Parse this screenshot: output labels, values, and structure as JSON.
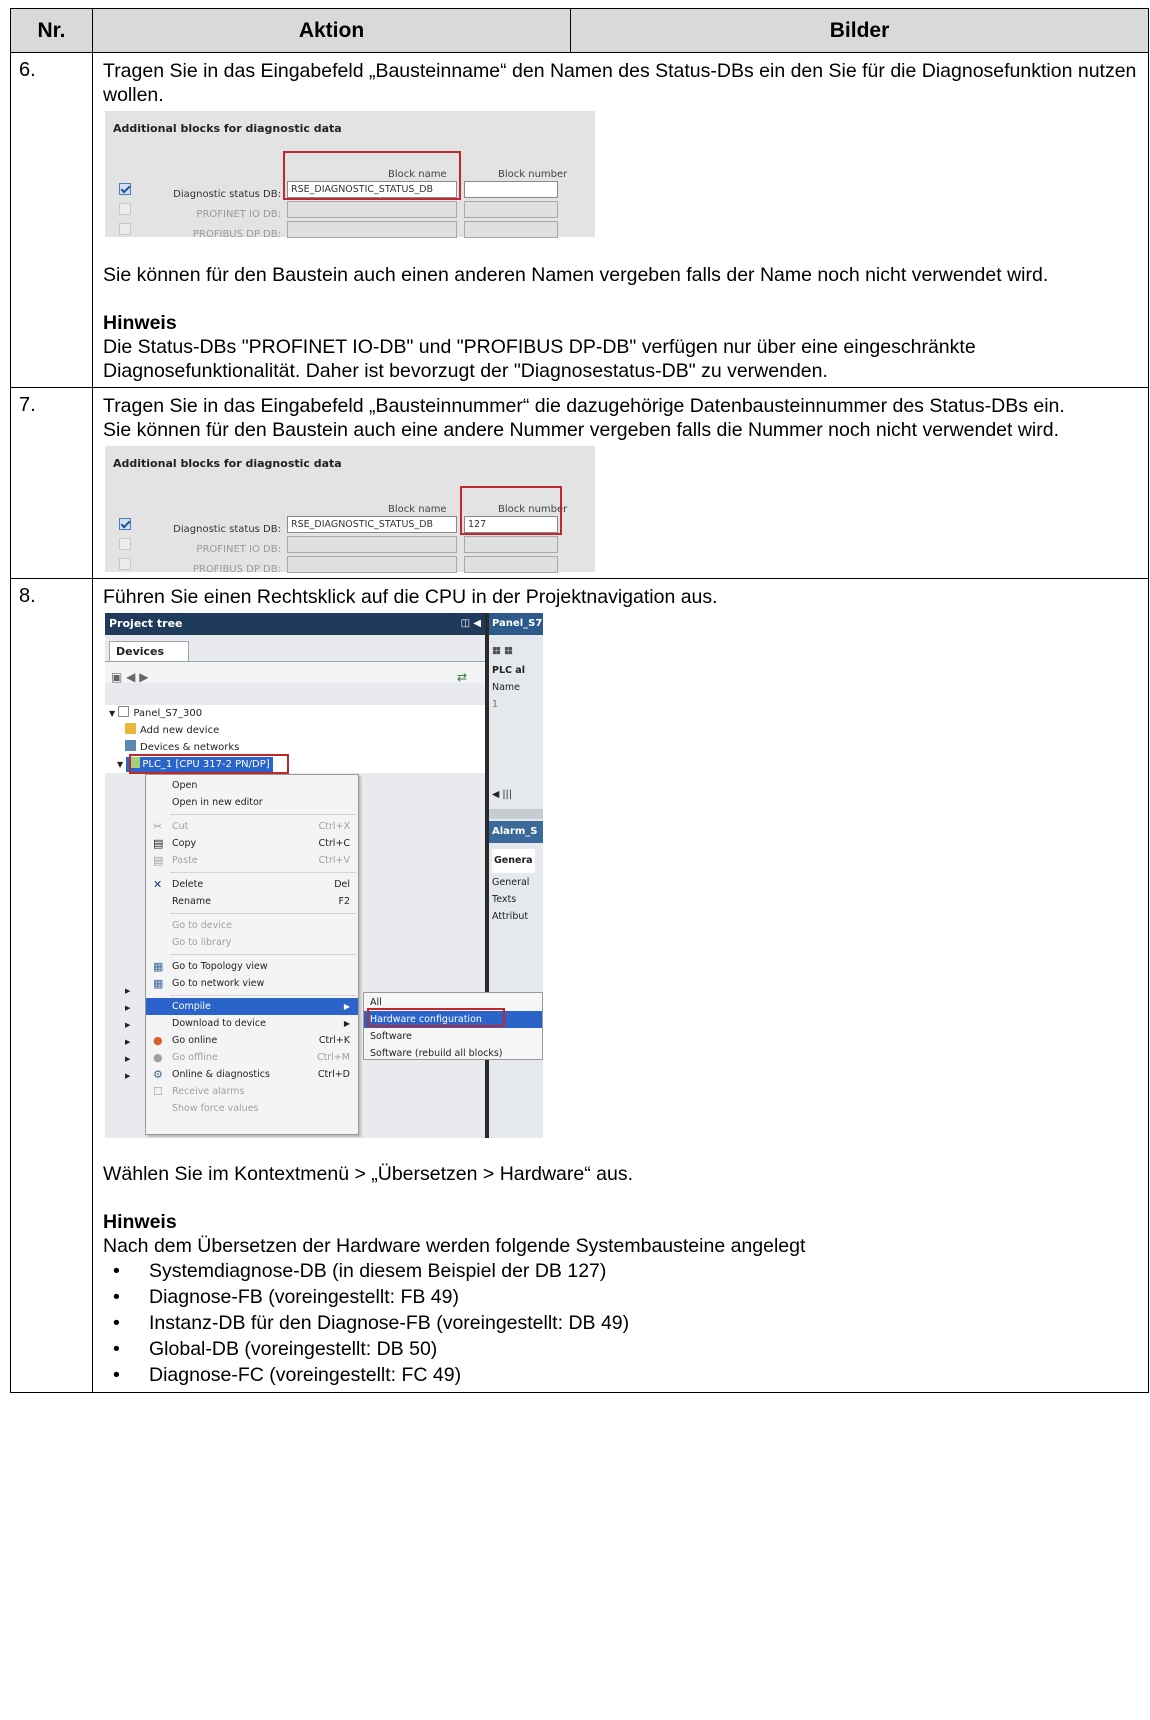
{
  "headers": {
    "nr": "Nr.",
    "aktion": "Aktion",
    "bilder": "Bilder"
  },
  "rows": [
    {
      "nr": "6.",
      "intro": "Tragen Sie in das Eingabefeld „Bausteinname“ den Namen des Status-DBs ein den Sie für die Diagnosefunktion nutzen wollen.",
      "after": "Sie können für den Baustein auch einen anderen Namen vergeben falls der Name noch nicht verwendet wird.",
      "hinweis_title": "Hinweis",
      "hinweis_text": "Die Status-DBs \"PROFINET IO-DB\" und \"PROFIBUS DP-DB\" verfügen nur über eine eingeschränkte Diagnosefunktionalität. Daher ist bevorzugt der \"Diagnosestatus-DB\" zu verwenden."
    },
    {
      "nr": "7.",
      "intro": "Tragen Sie in das Eingabefeld „Bausteinnummer“ die dazugehörige Datenbausteinnummer des Status-DBs ein.",
      "intro2": "Sie können für den Baustein auch eine andere Nummer vergeben falls die Nummer noch nicht verwendet wird."
    },
    {
      "nr": "8.",
      "intro": "Führen Sie einen Rechtsklick auf die CPU in der Projektnavigation aus.",
      "after": "Wählen Sie im Kontextmenü > „Übersetzen > Hardware“ aus.",
      "hinweis_title": "Hinweis",
      "hinweis_text": "Nach dem Übersetzen der Hardware werden folgende Systembausteine angelegt",
      "bullets": [
        "Systemdiagnose-DB (in diesem Beispiel der DB 127)",
        "Diagnose-FB (voreingestellt: FB 49)",
        "Instanz-DB für den Diagnose-FB (voreingestellt: DB 49)",
        "Global-DB (voreingestellt: DB 50)",
        "Diagnose-FC (voreingestellt: FC 49)"
      ]
    }
  ],
  "panel1": {
    "title": "Additional blocks for diagnostic data",
    "col_name": "Block name",
    "col_number": "Block number",
    "rows": [
      {
        "label": "Diagnostic status DB:",
        "name": "RSE_DIAGNOSTIC_STATUS_DB",
        "number": ""
      },
      {
        "label": "PROFINET IO DB:",
        "name": "",
        "number": ""
      },
      {
        "label": "PROFIBUS DP DB:",
        "name": "",
        "number": ""
      }
    ]
  },
  "panel2": {
    "title": "Additional blocks for diagnostic data",
    "col_name": "Block name",
    "col_number": "Block number",
    "rows": [
      {
        "label": "Diagnostic status DB:",
        "name": "RSE_DIAGNOSTIC_STATUS_DB",
        "number": "127"
      },
      {
        "label": "PROFINET IO DB:",
        "name": "",
        "number": ""
      },
      {
        "label": "PROFIBUS DP DB:",
        "name": "",
        "number": ""
      }
    ]
  },
  "tree": {
    "header": "Project tree",
    "right_header": "Panel_S7",
    "tab": "Devices",
    "nodes": [
      "Panel_S7_300",
      "Add new device",
      "Devices & networks",
      "PLC_1 [CPU 317-2 PN/DP]"
    ],
    "right_texts": [
      "PLC al",
      "Name",
      "1",
      "Alarm_S",
      "Genera",
      "General",
      "Texts",
      "Attribut"
    ],
    "menu": {
      "open": "Open",
      "open_new": "Open in new editor",
      "cut": "Cut",
      "cut_k": "Ctrl+X",
      "copy": "Copy",
      "copy_k": "Ctrl+C",
      "paste": "Paste",
      "paste_k": "Ctrl+V",
      "delete": "Delete",
      "delete_k": "Del",
      "rename": "Rename",
      "rename_k": "F2",
      "go_device": "Go to device",
      "go_library": "Go to library",
      "go_topology": "Go to Topology view",
      "go_network": "Go to network view",
      "compile": "Compile",
      "download": "Download to device",
      "go_online": "Go online",
      "go_online_k": "Ctrl+K",
      "go_offline": "Go offline",
      "go_offline_k": "Ctrl+M",
      "online_diag": "Online & diagnostics",
      "online_diag_k": "Ctrl+D",
      "receive_alarms": "Receive alarms",
      "show_force": "Show force values"
    },
    "submenu": [
      "All",
      "Hardware configuration",
      "Software",
      "Software (rebuild all blocks)"
    ]
  },
  "colors": {
    "highlight": "#c0282d",
    "header_bg": "#d9d9d9",
    "menu_selected": "#2a63c9",
    "tree_header": "#1f3a5a"
  }
}
